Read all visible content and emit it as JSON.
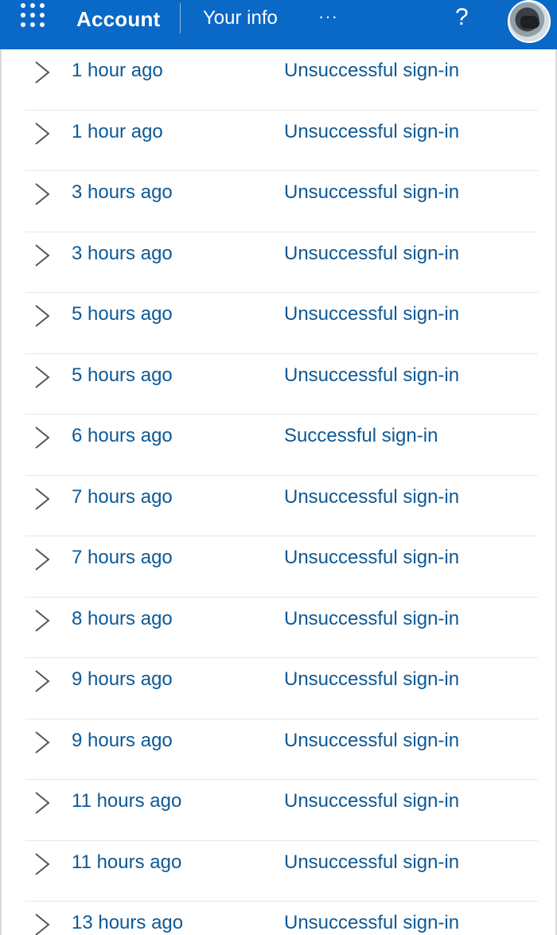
{
  "header": {
    "app_title": "Account",
    "nav_link": "Your info",
    "more_label": "···",
    "help_label": "?"
  },
  "colors": {
    "topbar": "#0a68c7",
    "link_text": "#0d5996"
  },
  "icons": {
    "waffle": "app-launcher-icon",
    "chevron": "chevron-right-icon",
    "avatar": "user-avatar"
  },
  "activity": {
    "rows": [
      {
        "time": "1 hour ago",
        "status": "Unsuccessful sign-in"
      },
      {
        "time": "1 hour ago",
        "status": "Unsuccessful sign-in"
      },
      {
        "time": "3 hours ago",
        "status": "Unsuccessful sign-in"
      },
      {
        "time": "3 hours ago",
        "status": "Unsuccessful sign-in"
      },
      {
        "time": "5 hours ago",
        "status": "Unsuccessful sign-in"
      },
      {
        "time": "5 hours ago",
        "status": "Unsuccessful sign-in"
      },
      {
        "time": "6 hours ago",
        "status": "Successful sign-in"
      },
      {
        "time": "7 hours ago",
        "status": "Unsuccessful sign-in"
      },
      {
        "time": "7 hours ago",
        "status": "Unsuccessful sign-in"
      },
      {
        "time": "8 hours ago",
        "status": "Unsuccessful sign-in"
      },
      {
        "time": "9 hours ago",
        "status": "Unsuccessful sign-in"
      },
      {
        "time": "9 hours ago",
        "status": "Unsuccessful sign-in"
      },
      {
        "time": "11 hours ago",
        "status": "Unsuccessful sign-in"
      },
      {
        "time": "11 hours ago",
        "status": "Unsuccessful sign-in"
      },
      {
        "time": "13 hours ago",
        "status": "Unsuccessful sign-in"
      }
    ]
  }
}
